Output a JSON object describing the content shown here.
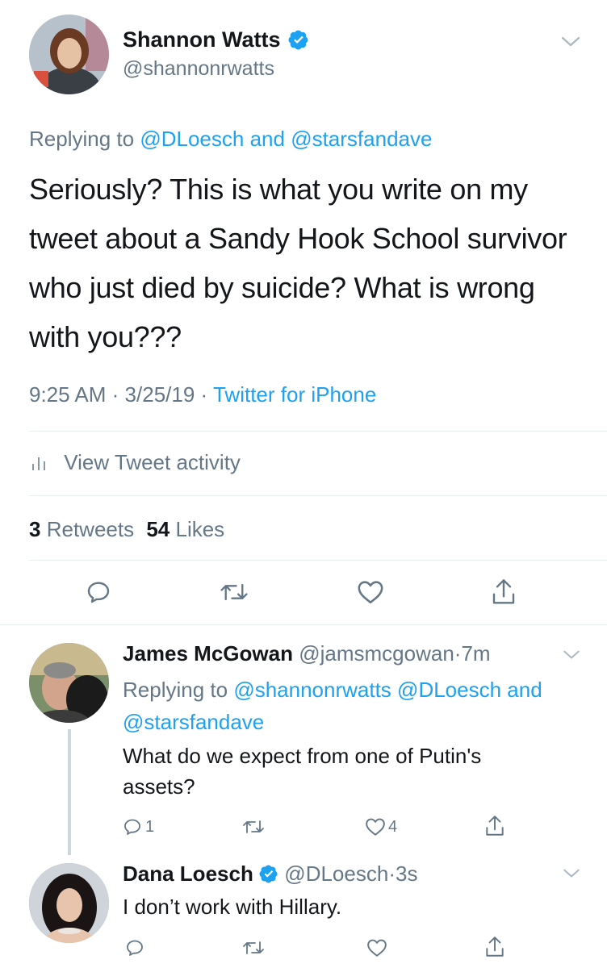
{
  "main_tweet": {
    "author_name": "Shannon Watts",
    "handle": "@shannonrwatts",
    "replying_prefix": "Replying to",
    "replying_user1": "@DLoesch",
    "replying_and": "and",
    "replying_user2": "@starsfandave",
    "text": "Seriously? This is what you write on my tweet about a Sandy Hook School survivor who just died by suicide? What is wrong with you???",
    "time": "9:25 AM",
    "date": "3/25/19",
    "separator": "·",
    "source": "Twitter for iPhone",
    "activity_label": "View Tweet activity",
    "retweets_count": "3",
    "retweets_label": "Retweets",
    "likes_count": "54",
    "likes_label": "Likes"
  },
  "reply1": {
    "author_name": "James McGowan",
    "handle": "@jamsmcgowan",
    "separator": "·",
    "time": "7m",
    "replying_prefix": "Replying to",
    "replying_user1": "@shannonrwatts",
    "replying_user2": "@DLoesch",
    "replying_and": "and",
    "replying_user3": "@starsfandave",
    "text": "What do we expect from one of Putin's assets?",
    "reply_count": "1",
    "like_count": "4"
  },
  "reply2": {
    "author_name": "Dana Loesch",
    "handle": "@DLoesch",
    "separator": "·",
    "time": "3s",
    "text": "I don’t work with Hillary."
  },
  "colors": {
    "accent": "#1da1f2",
    "secondary_text": "#657786",
    "divider": "#e6ecf0",
    "verified": "#1da1f2"
  },
  "icons": [
    "chevron-down-icon",
    "verified-icon",
    "reply-icon",
    "retweet-icon",
    "like-icon",
    "share-icon",
    "bar-chart-icon"
  ]
}
